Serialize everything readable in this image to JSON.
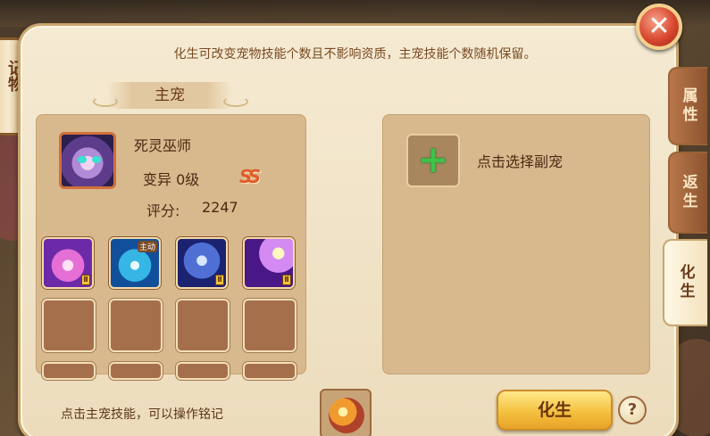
{
  "side_scroll": {
    "label": "记物"
  },
  "tip": "化生可改变宠物技能个数且不影响资质，主宠技能个数随机保留。",
  "close": {
    "label": "✕"
  },
  "tabs": [
    {
      "label": "属性",
      "active": false
    },
    {
      "label": "返生",
      "active": false
    },
    {
      "label": "化生",
      "active": true
    }
  ],
  "main_pet": {
    "header": "主宠",
    "name": "死灵巫师",
    "mutation": "变异 0级",
    "mutation_badge": "SS",
    "score_label": "评分:",
    "score_value": "2247",
    "skills": [
      {
        "icon": "pink-wings-skill",
        "level": "Ⅱ"
      },
      {
        "icon": "blue-vortex-skill",
        "tag": "主动"
      },
      {
        "icon": "dark-spirit-skill",
        "level": "Ⅱ"
      },
      {
        "icon": "purple-star-skill",
        "level": "Ⅱ"
      }
    ]
  },
  "sub_pet": {
    "add_icon": "+",
    "hint": "点击选择副宠"
  },
  "bottom": {
    "hint": "点击主宠技能，可以操作铭记",
    "rebirth_label": "化生",
    "help_label": "?"
  },
  "colors": {
    "panel_bg": "#f5ead2",
    "box_bg": "#d7b98d",
    "text_brown": "#4a2a14",
    "rebirth_button": "#f3bd3a",
    "add_green": "#3fc14a",
    "close_red": "#d9472f"
  }
}
